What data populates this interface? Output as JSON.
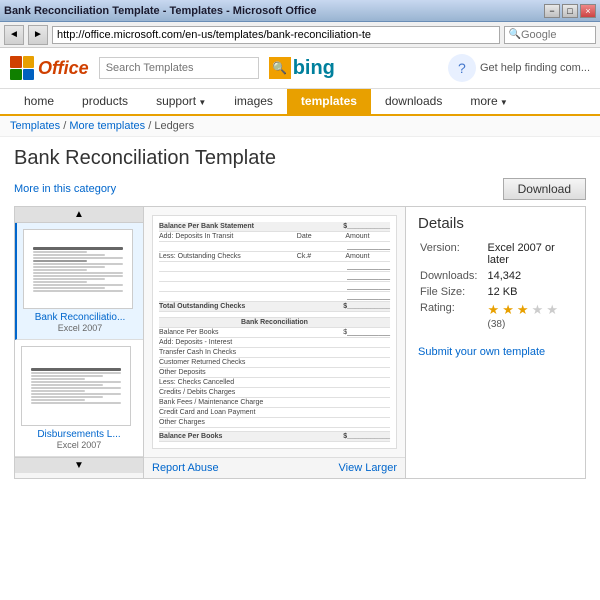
{
  "titleBar": {
    "title": "Bank Reconciliation Template - Templates - Microsoft Office",
    "buttons": [
      "−",
      "□",
      "×"
    ]
  },
  "addressBar": {
    "backLabel": "◄",
    "forwardLabel": "►",
    "url": "http://office.microsoft.com/en-us/templates/bank-reconciliation-te",
    "searchPlaceholder": "Google"
  },
  "officeHeader": {
    "logoAlt": "Office",
    "officeName": "Office",
    "searchPlaceholder": "Search Templates",
    "bingLabel": "bing",
    "helpText": "Get help finding com..."
  },
  "navTabs": [
    {
      "label": "home",
      "active": false
    },
    {
      "label": "products",
      "active": false
    },
    {
      "label": "support",
      "active": false,
      "arrow": true
    },
    {
      "label": "images",
      "active": false
    },
    {
      "label": "templates",
      "active": true
    },
    {
      "label": "downloads",
      "active": false
    },
    {
      "label": "more",
      "active": false,
      "arrow": true
    }
  ],
  "breadcrumb": {
    "items": [
      "Templates",
      "More templates",
      "Ledgers"
    ],
    "separator": " / "
  },
  "pageTitle": "Bank Reconciliation Template",
  "actionBar": {
    "moreCategoryLink": "More in this category",
    "downloadLabel": "Download"
  },
  "thumbnails": [
    {
      "label": "Bank Reconciliatio...",
      "sublabel": "Excel 2007",
      "active": true
    },
    {
      "label": "Disbursements L...",
      "sublabel": "Excel 2007",
      "active": false
    }
  ],
  "details": {
    "title": "Details",
    "rows": [
      {
        "key": "Version:",
        "value": "Excel 2007 or later"
      },
      {
        "key": "Downloads:",
        "value": "14,342"
      },
      {
        "key": "File Size:",
        "value": "12 KB"
      },
      {
        "key": "Rating:",
        "value": ""
      }
    ],
    "rating": {
      "filled": 3,
      "empty": 2,
      "count": "(38)"
    },
    "submitLink": "Submit your own template"
  },
  "preview": {
    "reportAbuseLabel": "Report Abuse",
    "viewLargerLabel": "View Larger"
  }
}
